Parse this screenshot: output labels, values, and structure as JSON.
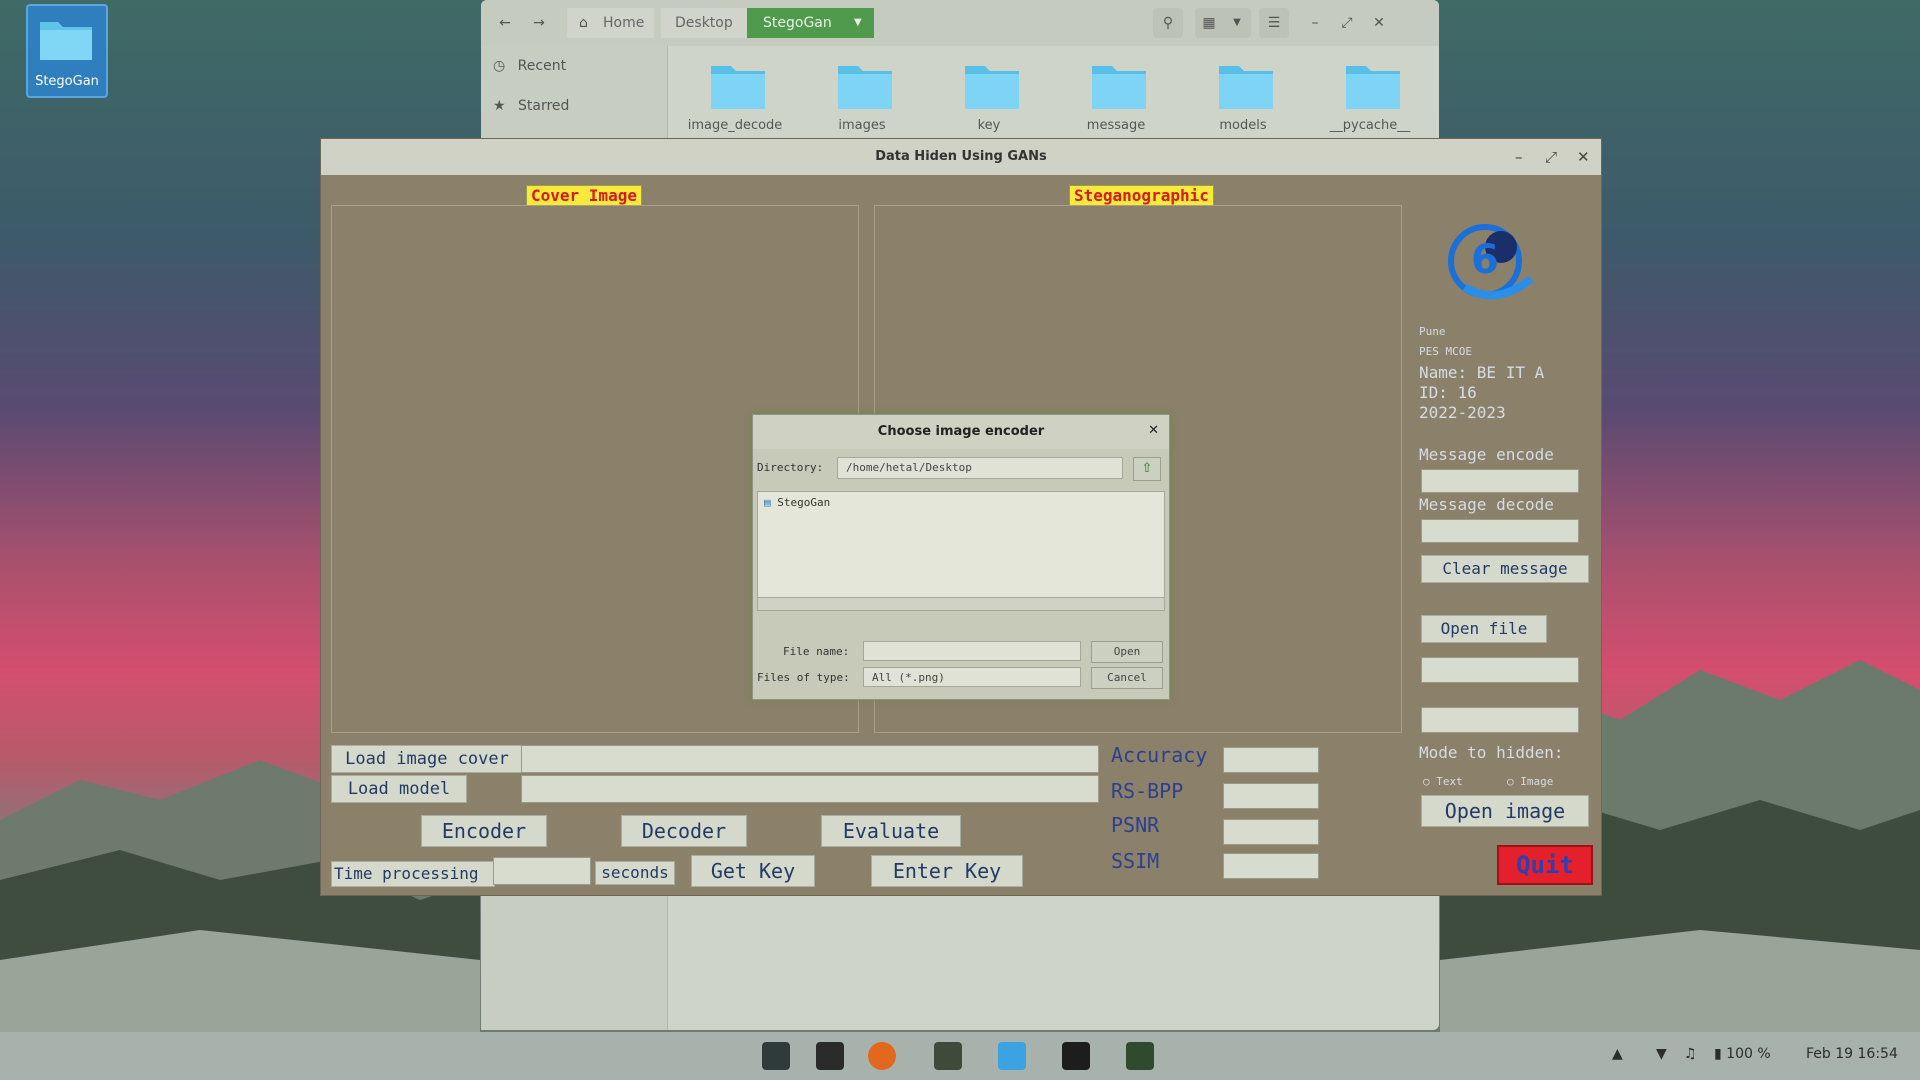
{
  "desktop": {
    "icon_label": "StegoGan"
  },
  "file_manager": {
    "breadcrumbs": [
      "Home",
      "Desktop",
      "StegoGan"
    ],
    "sidebar": [
      "Recent",
      "Starred"
    ],
    "folders": [
      "image_decode",
      "images",
      "key",
      "message",
      "models",
      "__pycache__"
    ]
  },
  "app": {
    "title": "Data Hiden Using GANs",
    "cover_label": "Cover Image",
    "stego_label": "Steganographic",
    "info": {
      "city": "Pune",
      "college": "PES MCOE",
      "name": "Name: BE IT A",
      "id": "ID: 16",
      "year": "2022-2023"
    },
    "message_encode_label": "Message encode",
    "message_decode_label": "Message decode",
    "clear_message": "Clear message",
    "open_file": "Open file",
    "mode_label": "Mode to hidden:",
    "mode_options": [
      "Text",
      "Image"
    ],
    "open_image": "Open image",
    "quit": "Quit",
    "load_image_cover": "Load image cover",
    "load_model": "Load model",
    "encoder": "Encoder",
    "decoder": "Decoder",
    "evaluate": "Evaluate",
    "time_processing": "Time processing",
    "seconds": "seconds",
    "get_key": "Get Key",
    "enter_key": "Enter Key",
    "metrics": [
      "Accuracy",
      "RS-BPP",
      "PSNR",
      "SSIM"
    ]
  },
  "dialog": {
    "title": "Choose image encoder",
    "directory_label": "Directory:",
    "directory_value": "/home/hetal/Desktop",
    "items": [
      "StegoGan"
    ],
    "file_name_label": "File name:",
    "files_of_type_label": "Files of type:",
    "files_of_type_value": "All (*.png)",
    "open": "Open",
    "cancel": "Cancel"
  },
  "taskbar": {
    "battery": "100 %",
    "datetime": "Feb 19  16:54"
  },
  "colors": {
    "accent_green": "#4f9a4c",
    "tag_yellow": "#f7ea3a",
    "quit_red": "#e4202c"
  }
}
